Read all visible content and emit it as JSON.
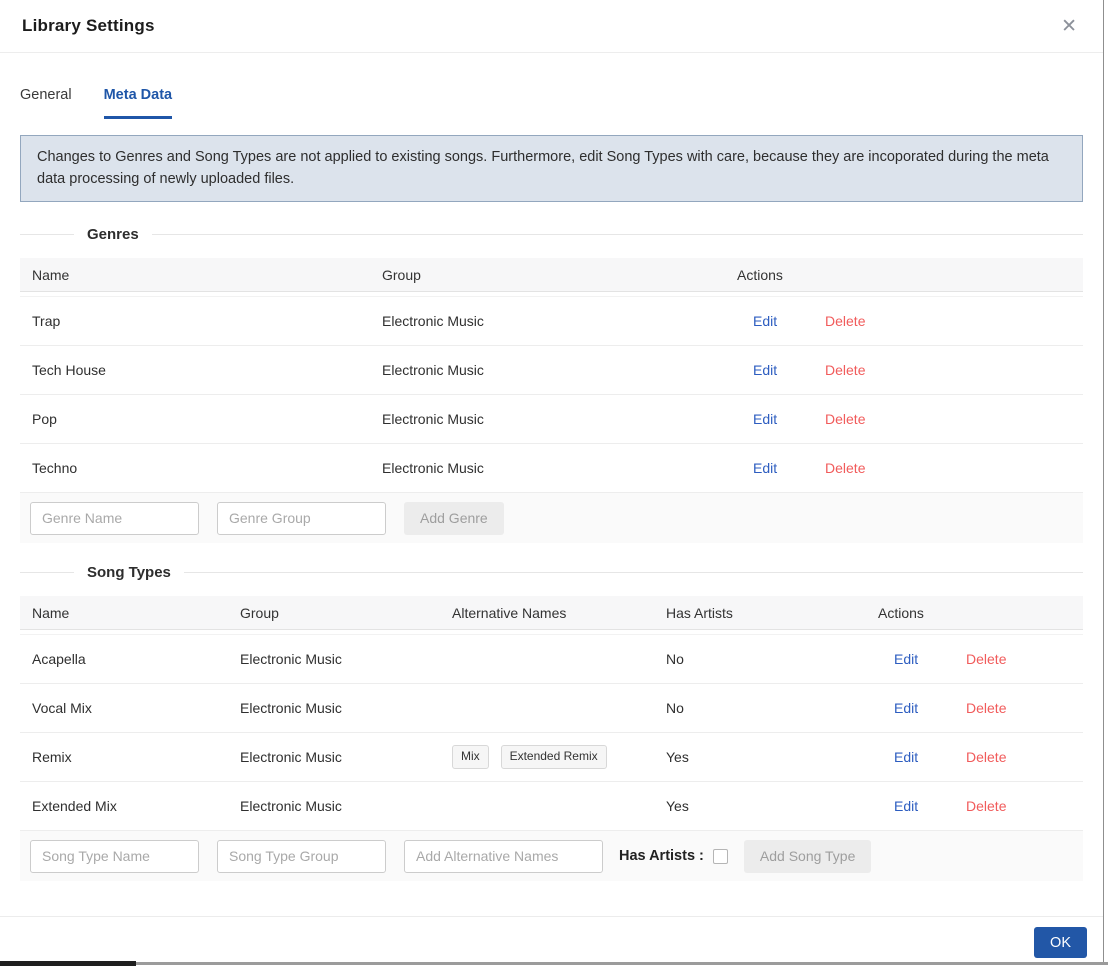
{
  "modal": {
    "title": "Library Settings",
    "close_icon": "✕",
    "ok_label": "OK"
  },
  "tabs": [
    {
      "label": "General",
      "active": false
    },
    {
      "label": "Meta Data",
      "active": true
    }
  ],
  "banner": {
    "text": "Changes to Genres and Song Types are not applied to existing songs. Furthermore, edit Song Types with care, because they are incoporated during the meta data processing of newly uploaded files."
  },
  "genres": {
    "section_title": "Genres",
    "columns": [
      "Name",
      "Group",
      "Actions"
    ],
    "edit_label": "Edit",
    "delete_label": "Delete",
    "rows": [
      {
        "name": "Trap",
        "group": "Electronic Music"
      },
      {
        "name": "Tech House",
        "group": "Electronic Music"
      },
      {
        "name": "Pop",
        "group": "Electronic Music"
      },
      {
        "name": "Techno",
        "group": "Electronic Music"
      }
    ],
    "inputs": {
      "name_placeholder": "Genre Name",
      "group_placeholder": "Genre Group",
      "add_button": "Add Genre"
    }
  },
  "song_types": {
    "section_title": "Song Types",
    "columns": [
      "Name",
      "Group",
      "Alternative Names",
      "Has Artists",
      "Actions"
    ],
    "edit_label": "Edit",
    "delete_label": "Delete",
    "rows": [
      {
        "name": "Acapella",
        "group": "Electronic Music",
        "alternative_names": [],
        "has_artists": "No"
      },
      {
        "name": "Vocal Mix",
        "group": "Electronic Music",
        "alternative_names": [],
        "has_artists": "No"
      },
      {
        "name": "Remix",
        "group": "Electronic Music",
        "alternative_names": [
          "Mix",
          "Extended Remix"
        ],
        "has_artists": "Yes"
      },
      {
        "name": "Extended Mix",
        "group": "Electronic Music",
        "alternative_names": [],
        "has_artists": "Yes"
      }
    ],
    "inputs": {
      "name_placeholder": "Song Type Name",
      "group_placeholder": "Song Type Group",
      "alt_placeholder": "Add Alternative Names",
      "has_artists_label": "Has Artists :",
      "has_artists_checked": false,
      "add_button": "Add Song Type"
    }
  },
  "colors": {
    "accent_blue": "#1f56a8",
    "link_blue": "#2d5dc0",
    "delete_red": "#f15b5b",
    "banner_bg": "#dce3ec",
    "banner_border": "#93a7be",
    "table_header_bg": "#f7f7f8",
    "ok_button_bg": "#2257a7"
  }
}
